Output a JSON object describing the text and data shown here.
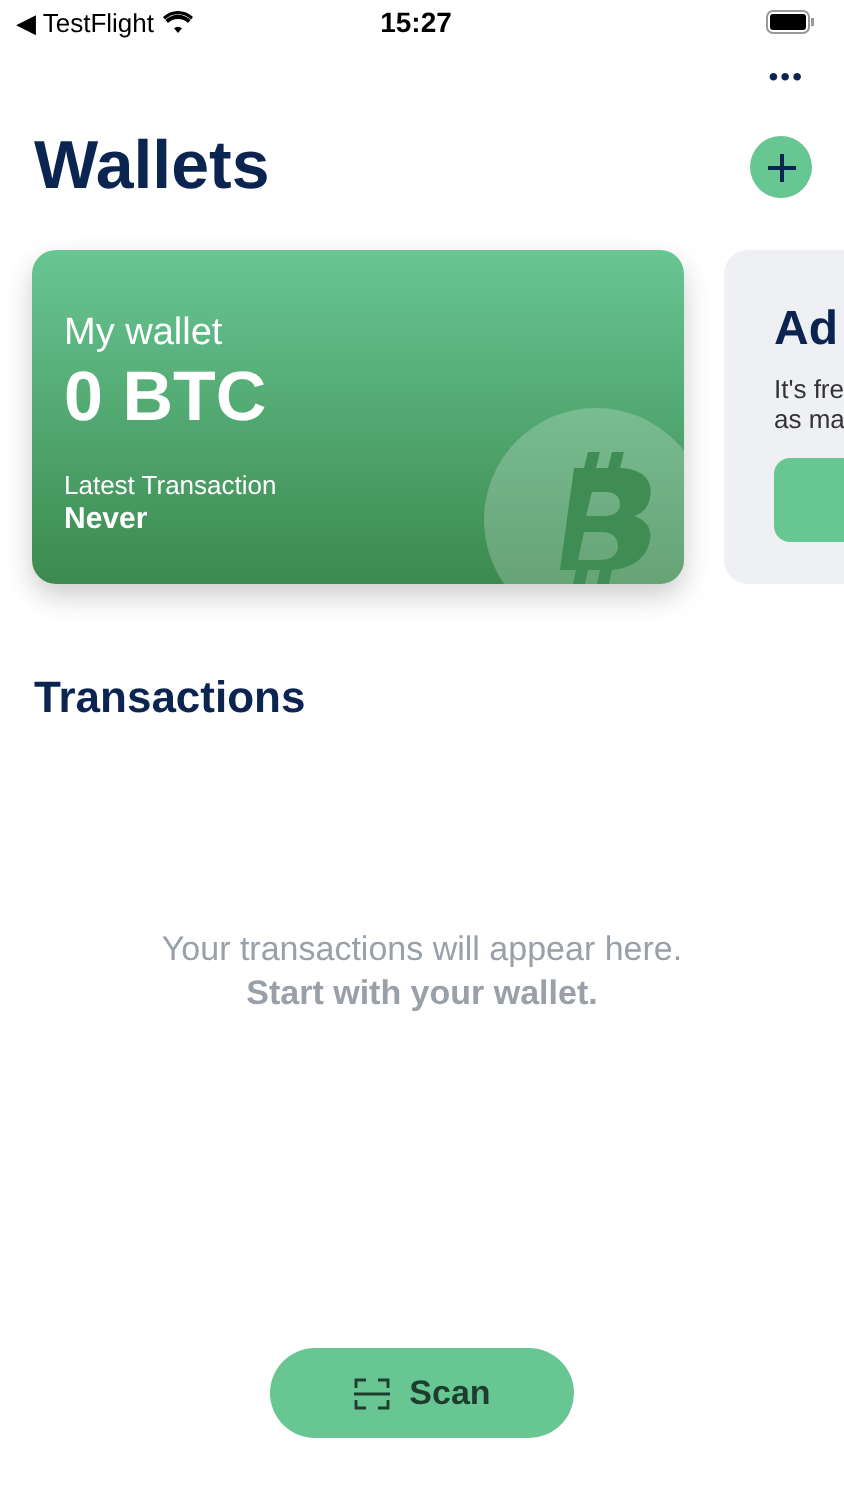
{
  "status_bar": {
    "back_app": "◀ TestFlight",
    "time": "15:27"
  },
  "header": {
    "more": "•••",
    "title": "Wallets"
  },
  "wallet_card": {
    "name": "My wallet",
    "balance": "0 BTC",
    "latest_label": "Latest Transaction",
    "latest_value": "Never"
  },
  "add_card": {
    "title": "Ad",
    "line_1": "It's fre",
    "line_2": "as ma"
  },
  "transactions": {
    "title": "Transactions",
    "empty_line_1": "Your transactions will appear here.",
    "empty_line_2": "Start with your wallet."
  },
  "scan_button": {
    "label": "Scan"
  }
}
